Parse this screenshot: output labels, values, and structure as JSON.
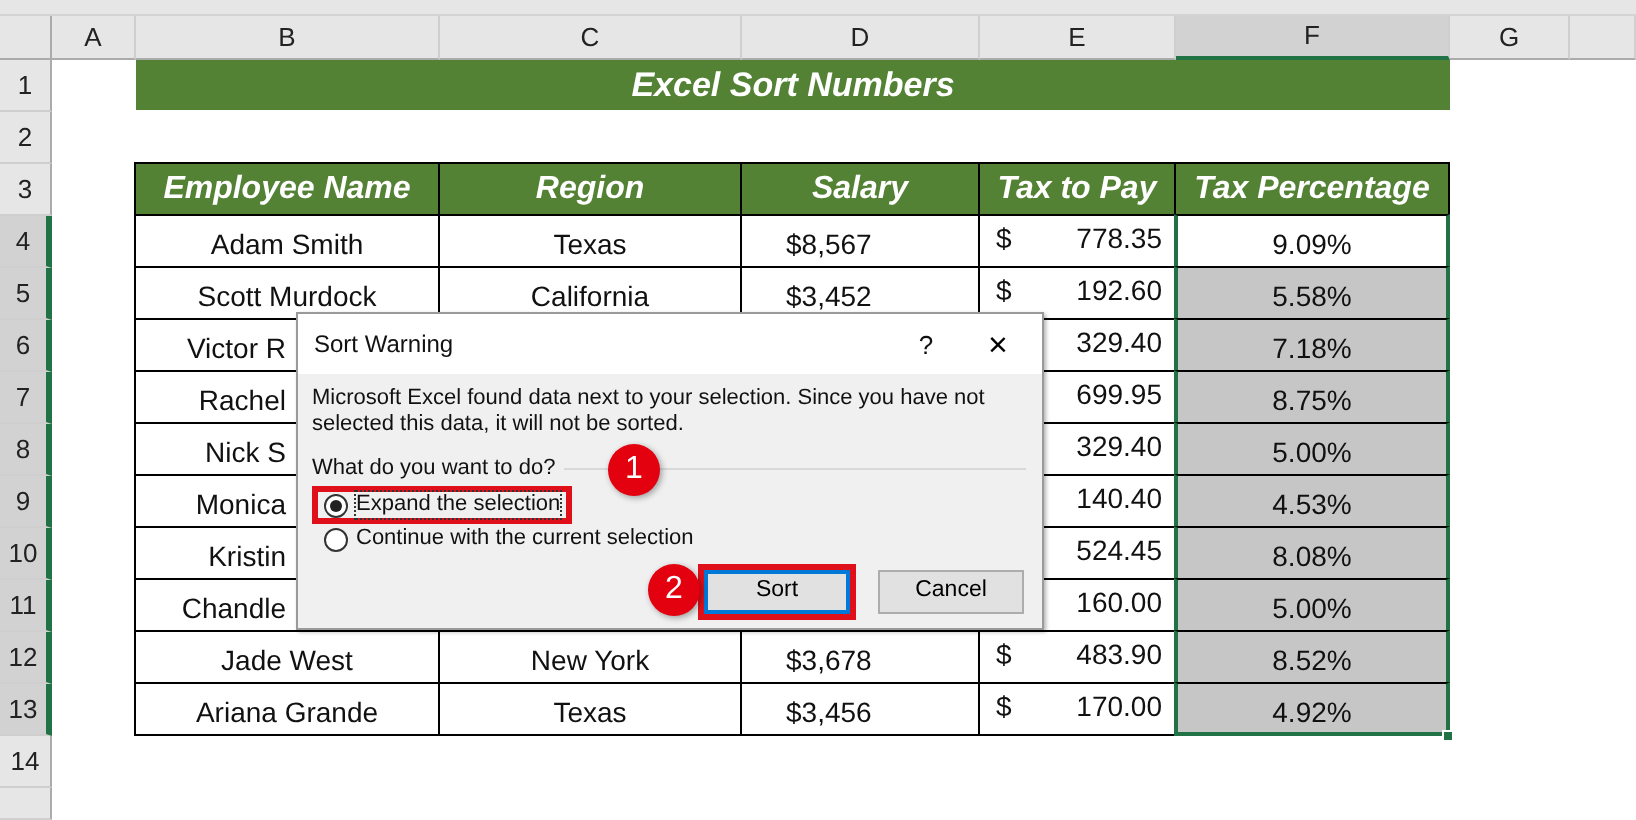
{
  "column_headers": [
    {
      "label": "A",
      "selected": false
    },
    {
      "label": "B",
      "selected": false
    },
    {
      "label": "C",
      "selected": false
    },
    {
      "label": "D",
      "selected": false
    },
    {
      "label": "E",
      "selected": false
    },
    {
      "label": "F",
      "selected": true
    },
    {
      "label": "G",
      "selected": false
    }
  ],
  "row_headers": [
    {
      "label": "1",
      "selected": false
    },
    {
      "label": "2",
      "selected": false
    },
    {
      "label": "3",
      "selected": false
    },
    {
      "label": "4",
      "selected": true
    },
    {
      "label": "5",
      "selected": true
    },
    {
      "label": "6",
      "selected": true
    },
    {
      "label": "7",
      "selected": true
    },
    {
      "label": "8",
      "selected": true
    },
    {
      "label": "9",
      "selected": true
    },
    {
      "label": "10",
      "selected": true
    },
    {
      "label": "11",
      "selected": true
    },
    {
      "label": "12",
      "selected": true
    },
    {
      "label": "13",
      "selected": true
    },
    {
      "label": "14",
      "selected": false
    }
  ],
  "title": "Excel Sort Numbers",
  "table": {
    "columns": [
      "Employee Name",
      "Region",
      "Salary",
      "Tax to Pay",
      "Tax Percentage"
    ],
    "rows": [
      {
        "name": "Adam Smith",
        "region": "Texas",
        "salary": "$8,567",
        "currency": "$",
        "tax": "778.35",
        "percentage": "9.09%",
        "active": true
      },
      {
        "name": "Scott Murdock",
        "region": "California",
        "salary": "$3,452",
        "currency": "$",
        "tax": "192.60",
        "percentage": "5.58%",
        "active": false
      },
      {
        "name": "Victor R",
        "region": null,
        "salary": null,
        "currency": null,
        "tax": "329.40",
        "percentage": "7.18%",
        "active": false
      },
      {
        "name": "Rachel",
        "region": null,
        "salary": null,
        "currency": null,
        "tax": "699.95",
        "percentage": "8.75%",
        "active": false
      },
      {
        "name": "Nick S",
        "region": null,
        "salary": null,
        "currency": null,
        "tax": "329.40",
        "percentage": "5.00%",
        "active": false
      },
      {
        "name": "Monica",
        "region": null,
        "salary": null,
        "currency": null,
        "tax": "140.40",
        "percentage": "4.53%",
        "active": false
      },
      {
        "name": "Kristin",
        "region": null,
        "salary": null,
        "currency": null,
        "tax": "524.45",
        "percentage": "8.08%",
        "active": false
      },
      {
        "name": "Chandle",
        "region": null,
        "salary": null,
        "currency": null,
        "tax": "160.00",
        "percentage": "5.00%",
        "active": false
      },
      {
        "name": "Jade West",
        "region": "New York",
        "salary": "$3,678",
        "currency": "$",
        "tax": "483.90",
        "percentage": "8.52%",
        "active": false
      },
      {
        "name": "Ariana Grande",
        "region": "Texas",
        "salary": "$3,456",
        "currency": "$",
        "tax": "170.00",
        "percentage": "4.92%",
        "active": false
      }
    ]
  },
  "dialog": {
    "title": "Sort Warning",
    "help": "?",
    "close": "×",
    "message": "Microsoft Excel found data next to your selection.  Since you have not selected this data, it will not be sorted.",
    "question": "What do you want to do?",
    "options": [
      {
        "label": "Expand the selection",
        "selected": true,
        "highlighted": true
      },
      {
        "label": "Continue with the current selection",
        "selected": false,
        "highlighted": false
      }
    ],
    "buttons": [
      {
        "label": "Sort",
        "focused": true,
        "highlighted": true
      },
      {
        "label": "Cancel",
        "focused": false,
        "highlighted": false
      }
    ]
  },
  "callouts": [
    {
      "label": "1"
    },
    {
      "label": "2"
    }
  ]
}
